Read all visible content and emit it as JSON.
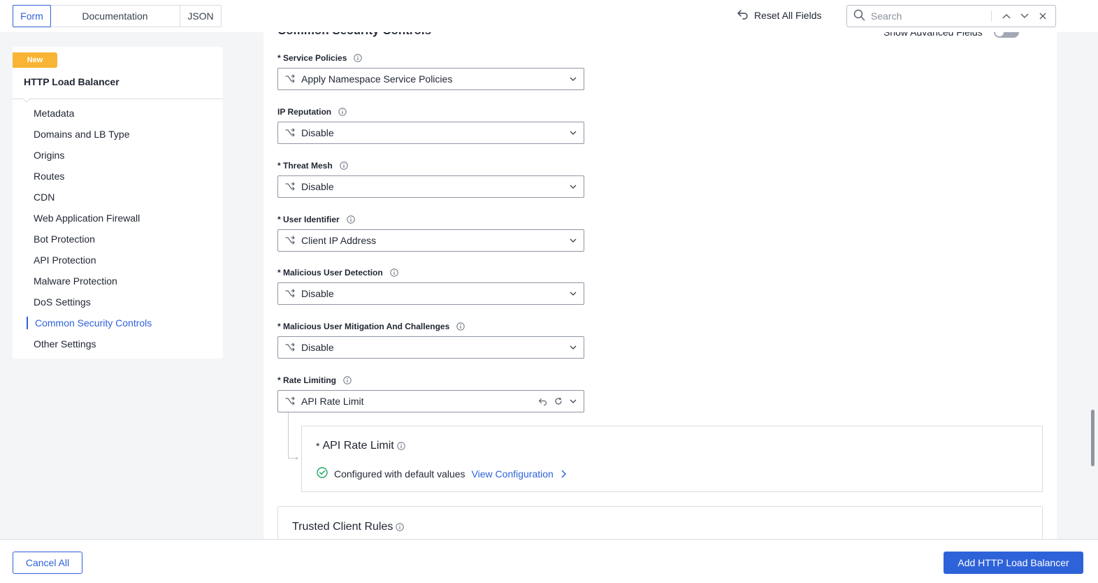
{
  "view_tabs": [
    {
      "label": "Form",
      "active": true
    },
    {
      "label": "Documentation",
      "active": false
    },
    {
      "label": "JSON",
      "active": false
    }
  ],
  "toolbar": {
    "reset_label": "Reset All Fields",
    "search_placeholder": "Search"
  },
  "sidebar": {
    "badge": "New",
    "title": "HTTP Load Balancer",
    "items": [
      {
        "label": "Metadata"
      },
      {
        "label": "Domains and LB Type"
      },
      {
        "label": "Origins"
      },
      {
        "label": "Routes"
      },
      {
        "label": "CDN"
      },
      {
        "label": "Web Application Firewall"
      },
      {
        "label": "Bot Protection"
      },
      {
        "label": "API Protection"
      },
      {
        "label": "Malware Protection"
      },
      {
        "label": "DoS Settings"
      },
      {
        "label": "Common Security Controls",
        "active": true
      },
      {
        "label": "Other Settings"
      }
    ]
  },
  "section": {
    "heading": "Common Security Controls",
    "show_advanced_label": "Show Advanced Fields"
  },
  "fields": [
    {
      "label": "* Service Policies",
      "value": "Apply Namespace Service Policies"
    },
    {
      "label": "IP Reputation",
      "value": "Disable"
    },
    {
      "label": "* Threat Mesh",
      "value": "Disable"
    },
    {
      "label": "* User Identifier",
      "value": "Client IP Address"
    },
    {
      "label": "* Malicious User Detection",
      "value": "Disable"
    },
    {
      "label": "* Malicious User Mitigation And Challenges",
      "value": "Disable"
    },
    {
      "label": "* Rate Limiting",
      "value": "API Rate Limit"
    }
  ],
  "sub_card": {
    "required_mark": "*",
    "title": "API Rate Limit",
    "status_text": "Configured with default values",
    "link_label": "View Configuration"
  },
  "trusted_card": {
    "title": "Trusted Client Rules"
  },
  "footer": {
    "cancel_label": "Cancel All",
    "submit_label": "Add HTTP Load Balancer"
  },
  "colors": {
    "accent": "#2e62d9",
    "badge": "#f9b434",
    "success": "#1fa864"
  }
}
